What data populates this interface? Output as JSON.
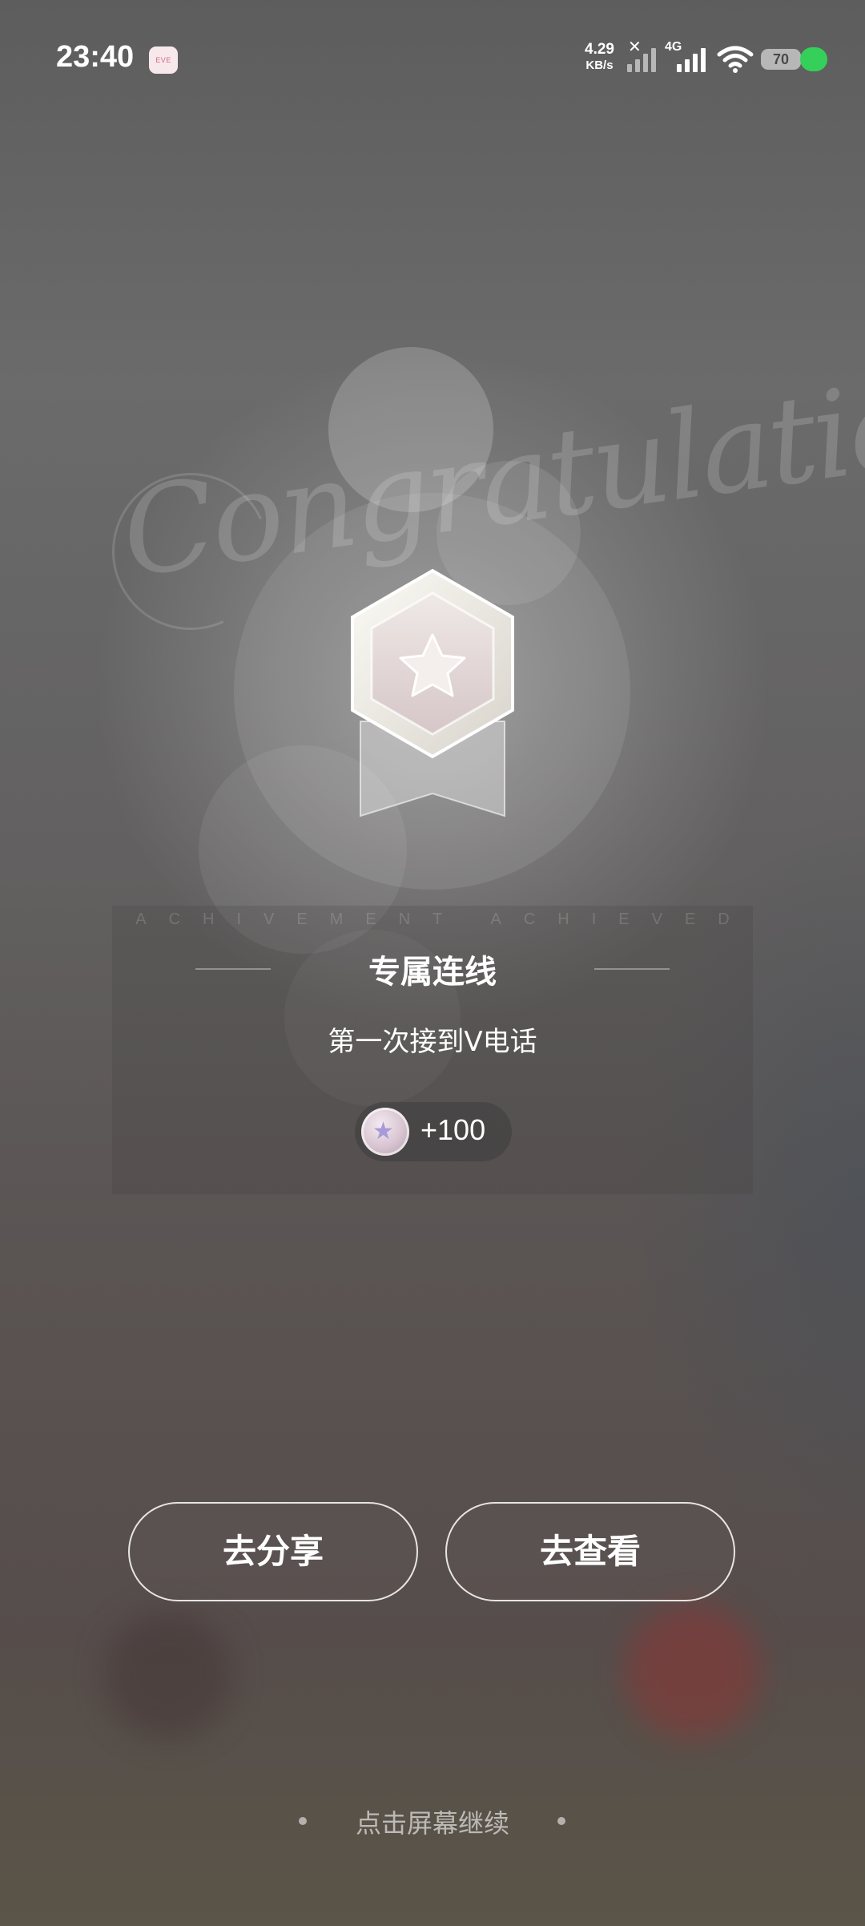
{
  "status_bar": {
    "time": "23:40",
    "app_badge": "EVE",
    "net_speed_value": "4.29",
    "net_speed_unit": "KB/s",
    "network_type": "4G",
    "battery_level": "70",
    "icons": [
      "muted-sim-signal-icon",
      "signal-icon",
      "wifi-icon",
      "battery-icon",
      "charging-indicator-icon"
    ]
  },
  "background": {
    "script_text": "Congratulation"
  },
  "achievement": {
    "subtitle": "ACHIVEMENT ACHIEVED",
    "title": "专属连线",
    "description": "第一次接到V电话",
    "reward_amount": "+100",
    "medal_icon": "star-medal-icon",
    "reward_icon": "star-coin-icon"
  },
  "actions": {
    "share_label": "去分享",
    "view_label": "去查看"
  },
  "footer": {
    "continue_text": "点击屏幕继续"
  },
  "colors": {
    "charging_green": "#35d05a",
    "app_badge_bg": "#f7e8ec",
    "coin_star": "#a69bd8"
  }
}
